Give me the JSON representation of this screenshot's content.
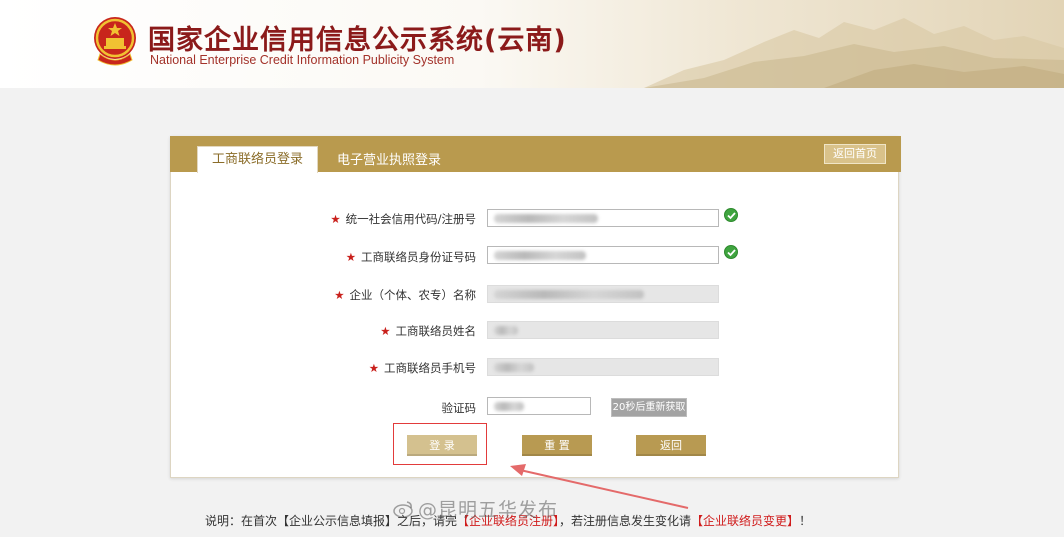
{
  "header": {
    "title": "国家企业信用信息公示系统(云南)",
    "subtitle": "National Enterprise Credit Information Publicity System"
  },
  "tabs": [
    {
      "label": "工商联络员登录",
      "active": true
    },
    {
      "label": "电子营业执照登录",
      "active": false
    }
  ],
  "home_button": "返回首页",
  "form": {
    "fields": [
      {
        "label": "统一社会信用代码/注册号",
        "required": true,
        "readonly": false,
        "verified": true
      },
      {
        "label": "工商联络员身份证号码",
        "required": true,
        "readonly": false,
        "verified": true
      },
      {
        "label": "企业（个体、农专）名称",
        "required": true,
        "readonly": true,
        "verified": false
      },
      {
        "label": "工商联络员姓名",
        "required": true,
        "readonly": true,
        "verified": false
      },
      {
        "label": "工商联络员手机号",
        "required": true,
        "readonly": true,
        "verified": false
      }
    ],
    "captcha_label": "验证码",
    "sms_button": "20秒后重新获取",
    "required_mark": "★"
  },
  "actions": {
    "login": "登 录",
    "reset": "重 置",
    "back": "返回"
  },
  "footer": {
    "prefix": "说明：在首次【企业公示信息填报】之后，请完",
    "link1": "【企业联络员注册】",
    "middle": "，若注册信息发生变化请",
    "link2": "【企业联络员变更】",
    "suffix": "！"
  },
  "watermark": "@昆明五华发布",
  "colors": {
    "panel_header": "#b99a4e",
    "button": "#b89a52",
    "title_red": "#8b1a1a",
    "highlight_red": "#e23b3b",
    "check_green": "#3fa43f"
  }
}
